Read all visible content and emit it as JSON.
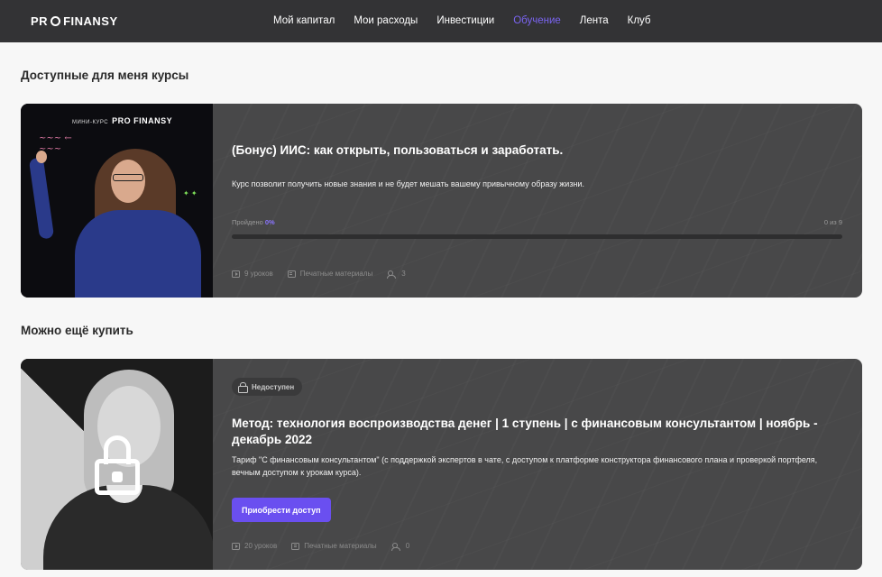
{
  "header": {
    "logo_left": "PR",
    "logo_right": "FINANSY",
    "nav": [
      {
        "label": "Мой капитал",
        "active": false
      },
      {
        "label": "Мои расходы",
        "active": false
      },
      {
        "label": "Инвестиции",
        "active": false
      },
      {
        "label": "Обучение",
        "active": true
      },
      {
        "label": "Лента",
        "active": false
      },
      {
        "label": "Клуб",
        "active": false
      }
    ]
  },
  "sections": {
    "available_title": "Доступные для меня курсы",
    "buy_title": "Можно ещё купить"
  },
  "course1": {
    "thumb_label": "МИНИ-КУРС",
    "thumb_brand": "PRO FINANSY",
    "title": "(Бонус) ИИС: как открыть, пользоваться и заработать.",
    "description": "Курс позволит получить новые знания и не будет мешать вашему привычному образу жизни.",
    "progress_label": "Пройдено",
    "progress_pct": "0%",
    "progress_count": "0 из 9",
    "progress_value": 0,
    "lessons": "9 уроков",
    "materials": "Печатные материалы",
    "students": "3"
  },
  "course2": {
    "badge": "Недоступен",
    "title": "Метод: технология воспроизводства денег | 1 ступень | с финансовым консультантом | ноябрь - декабрь 2022",
    "description": "Тариф \"С финансовым консультантом\" (с поддержкой экспертов в чате, с доступом к платформе конструктора финансового плана и проверкой портфеля, вечным доступом к урокам курса).",
    "button": "Приобрести доступ",
    "lessons": "20 уроков",
    "materials": "Печатные материалы",
    "students": "0"
  },
  "colors": {
    "accent": "#7a64f0",
    "header_bg": "#333335",
    "card_bg": "#484849",
    "button_bg": "#6a4ff0"
  }
}
